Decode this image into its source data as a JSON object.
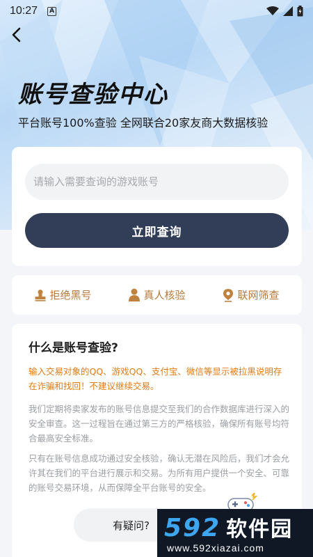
{
  "status_bar": {
    "time": "10:27",
    "notification_badge": "A",
    "icons": [
      "wifi-icon",
      "signal-icon",
      "battery-icon"
    ]
  },
  "header": {
    "back_icon": "chevron-left-icon",
    "title": "账号查验中心",
    "subtitle": "平台账号100%查验  全网联合20家友商大数据核验"
  },
  "search": {
    "placeholder": "请输入需要查询的游戏账号",
    "value": "",
    "submit_label": "立即查询"
  },
  "features": [
    {
      "label": "拒绝黑号",
      "icon": "stamp-icon"
    },
    {
      "label": "真人核验",
      "icon": "person-icon"
    },
    {
      "label": "联网筛查",
      "icon": "location-pin-icon"
    }
  ],
  "info": {
    "title": "什么是账号查验?",
    "warning": "输入交易对象的QQ、游戏QQ、支付宝、微信等显示被拉黑说明存在诈骗和找回！不建议继续交易。",
    "paragraph_1": "我们定期将卖家发布的账号信息提交至我们的合作数据库进行深入的安全审查。这一过程旨在通过第三方的严格核验，确保所有账号均符合最高安全标准。",
    "paragraph_2": "只有在账号信息成功通过安全核验，确认无潜在风险后，我们才会允许其在我们的平台进行展示和交易。为所有用户提供一个安全、可靠的账号交易环境，从而保障全平台账号的安全。"
  },
  "help": {
    "label": "有疑问?"
  },
  "watermark": {
    "number": "592",
    "name": "软件园",
    "url": "www.592xiazai.com"
  },
  "colors": {
    "primary_button": "#323e57",
    "accent_orange": "#b77a3d",
    "warning_orange": "#e07b17",
    "muted_text": "#9b9ea3",
    "watermark_blue": "#3ea5f1"
  }
}
